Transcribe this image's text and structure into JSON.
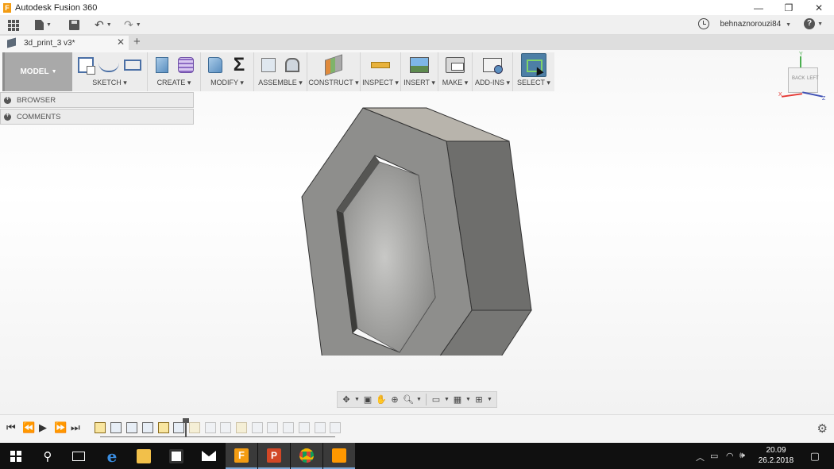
{
  "window": {
    "title": "Autodesk Fusion 360",
    "minimize": "—",
    "restore": "❐",
    "close": "✕"
  },
  "appbar": {
    "user": "behnaznorouzi84",
    "help": "?"
  },
  "tabs": {
    "document": "3d_print_3 v3*",
    "close": "✕",
    "new": "+"
  },
  "workspace": {
    "label": "MODEL"
  },
  "toolbar": {
    "groups": [
      {
        "id": "sketch",
        "label": "SKETCH"
      },
      {
        "id": "create",
        "label": "CREATE"
      },
      {
        "id": "modify",
        "label": "MODIFY"
      },
      {
        "id": "assemble",
        "label": "ASSEMBLE"
      },
      {
        "id": "construct",
        "label": "CONSTRUCT"
      },
      {
        "id": "inspect",
        "label": "INSPECT"
      },
      {
        "id": "insert",
        "label": "INSERT"
      },
      {
        "id": "make",
        "label": "MAKE"
      },
      {
        "id": "addins",
        "label": "ADD-INS"
      },
      {
        "id": "select",
        "label": "SELECT"
      }
    ],
    "modify_symbol": "Σ"
  },
  "panels": {
    "browser": "BROWSER",
    "comments": "COMMENTS"
  },
  "viewcube": {
    "back": "BACK",
    "left": "LEFT",
    "x": "X",
    "y": "Y",
    "z": "Z"
  },
  "colors": {
    "accent": "#4d7fa6",
    "model_face_front": "#8e8e8c",
    "model_face_side": "#6e6e6c",
    "model_face_top": "#b8b4ac"
  },
  "timeline": {
    "settings_icon": "gear-icon"
  },
  "taskbar": {
    "apps": [
      "windows-start",
      "search",
      "task-view",
      "edge",
      "file-explorer",
      "store",
      "mail",
      "fusion-360",
      "powerpoint",
      "chrome",
      "sublime-text"
    ],
    "time": "20.09",
    "date": "26.2.2018"
  }
}
